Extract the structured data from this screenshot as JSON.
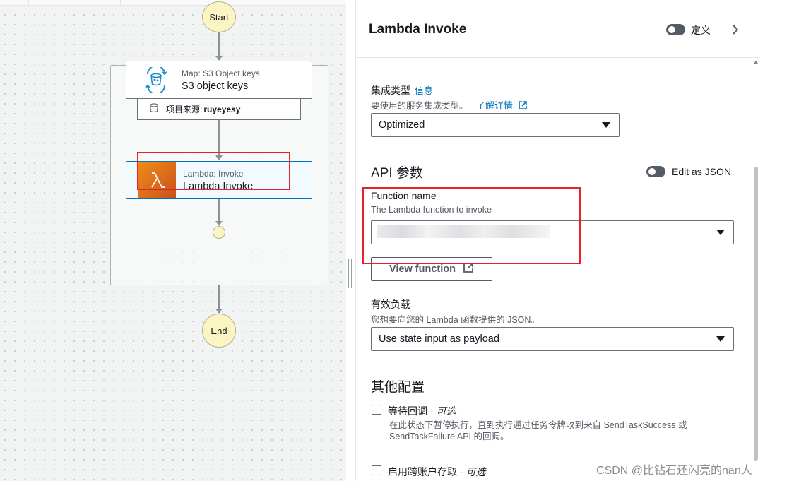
{
  "canvas": {
    "start_label": "Start",
    "end_label": "End",
    "map_state": {
      "type_label": "Map: S3 Object keys",
      "name": "S3 object keys"
    },
    "items_source": {
      "prefix": "项目来源:",
      "value": "ruyeyesy"
    },
    "lambda_state": {
      "type_label": "Lambda: Invoke",
      "name": "Lambda Invoke"
    }
  },
  "panel": {
    "title": "Lambda Invoke",
    "definition_toggle_label": "定义",
    "integration": {
      "label": "集成类型",
      "info": "信息",
      "desc": "要使用的服务集成类型。",
      "learn_more": "了解详情",
      "selected": "Optimized"
    },
    "api_params": {
      "title": "API 参数",
      "edit_json_label": "Edit as JSON",
      "function_name_label": "Function name",
      "function_name_desc": "The Lambda function to invoke",
      "view_function": "View function"
    },
    "payload": {
      "label": "有效负载",
      "desc": "您想要向您的 Lambda 函数提供的 JSON。",
      "selected": "Use state input as payload"
    },
    "other": {
      "title": "其他配置",
      "wait_callback": {
        "label": "等待回调 -",
        "optional": "可选",
        "desc_line1": "在此状态下暂停执行，直到执行通过任务令牌收到来自 SendTaskSuccess 或",
        "desc_line2": "SendTaskFailure API 的回调。"
      },
      "cross_account": {
        "label": "启用跨账户存取 -",
        "optional": "可选"
      }
    }
  },
  "watermark": "CSDN @比钻石还闪亮的nan人",
  "colors": {
    "accent_link": "#0073bb",
    "highlight": "#e8222a",
    "lambda_orange": "#e8760c",
    "node_yellow": "#fbf5c4"
  }
}
